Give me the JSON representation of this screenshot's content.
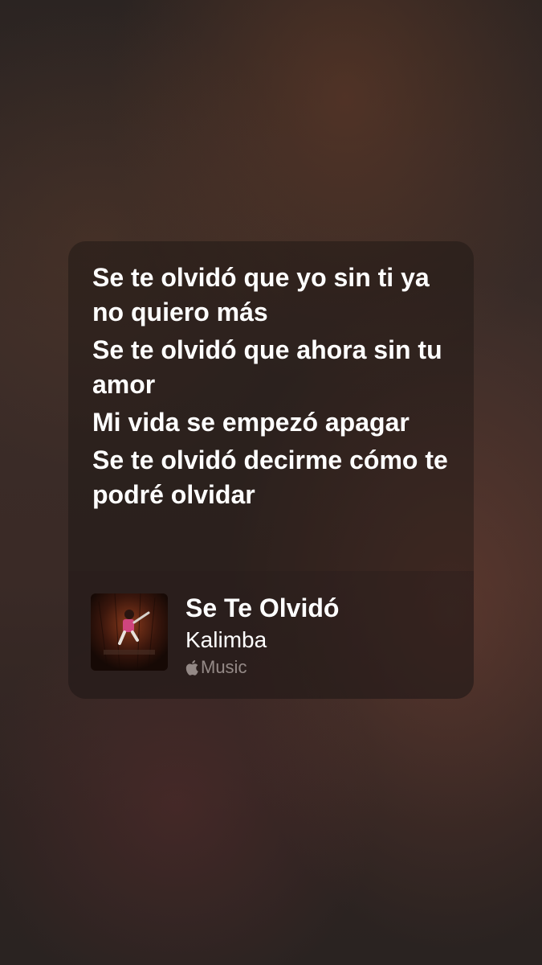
{
  "lyrics": {
    "lines": [
      "Se te olvidó que yo sin ti ya no quiero más",
      "Se te olvidó que ahora sin tu amor",
      "Mi vida se empezó apagar",
      "Se te olvidó decirme cómo te podré olvidar"
    ]
  },
  "track": {
    "title": "Se Te Olvidó",
    "artist": "Kalimba",
    "service_label": "Music",
    "service_icon": "apple-logo-icon",
    "artwork_icon": "album-artwork"
  },
  "colors": {
    "text_primary": "#ffffff",
    "text_secondary": "#bdb2ae"
  }
}
